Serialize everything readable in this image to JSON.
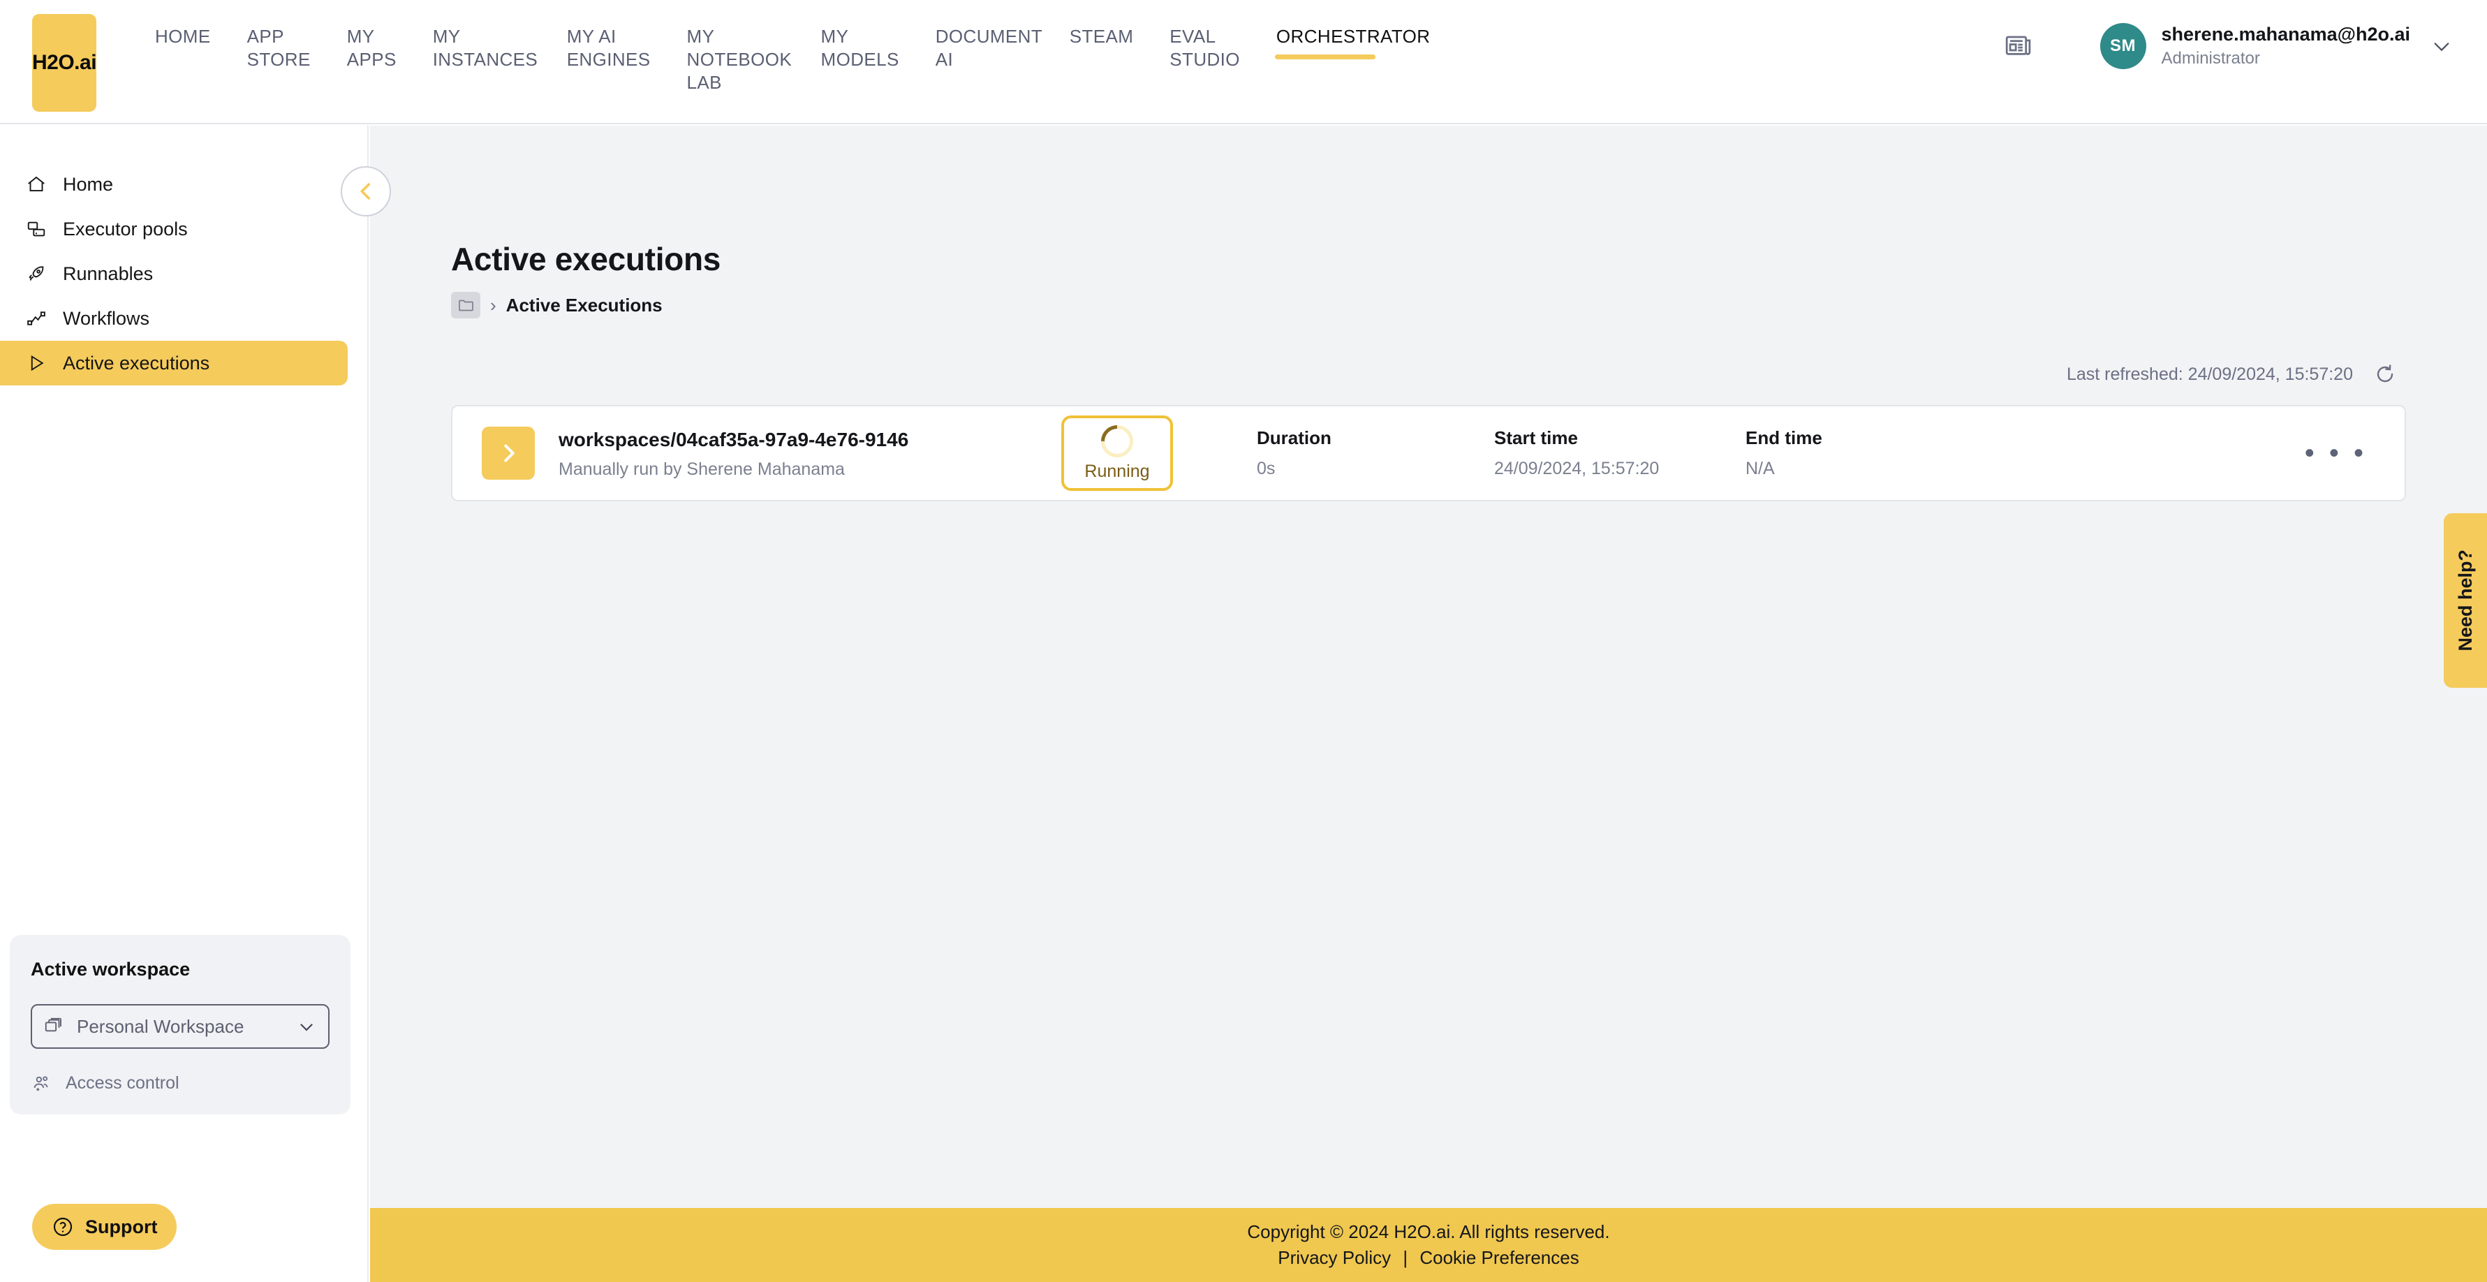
{
  "brand": {
    "logo_text": "H2O.ai",
    "accent_yellow": "#F5CB5C",
    "accent_yellow_dark": "#F0C136",
    "avatar_teal": "#2F8A8A",
    "text_dark": "#15161a",
    "text_muted": "#7b808f"
  },
  "topnav": {
    "items": [
      {
        "label": "HOME",
        "active": false
      },
      {
        "label": "APP\nSTORE",
        "active": false
      },
      {
        "label": "MY\nAPPS",
        "active": false
      },
      {
        "label": "MY\nINSTANCES",
        "active": false
      },
      {
        "label": "MY AI\nENGINES",
        "active": false
      },
      {
        "label": "MY\nNOTEBOOK\nLAB",
        "active": false
      },
      {
        "label": "MY\nMODELS",
        "active": false
      },
      {
        "label": "DOCUMENT\nAI",
        "active": false
      },
      {
        "label": "STEAM",
        "active": false
      },
      {
        "label": "EVAL\nSTUDIO",
        "active": false
      },
      {
        "label": "ORCHESTRATOR",
        "active": true
      }
    ],
    "news_icon": "newspaper-icon",
    "user": {
      "initials": "SM",
      "email": "sherene.mahanama@h2o.ai",
      "role": "Administrator",
      "caret_icon": "chevron-down-icon"
    }
  },
  "sidebar": {
    "collapse_icon": "chevron-left-icon",
    "items": [
      {
        "label": "Home",
        "icon": "home-icon",
        "selected": false
      },
      {
        "label": "Executor pools",
        "icon": "executor-pools-icon",
        "selected": false
      },
      {
        "label": "Runnables",
        "icon": "rocket-icon",
        "selected": false
      },
      {
        "label": "Workflows",
        "icon": "workflow-icon",
        "selected": false
      },
      {
        "label": "Active executions",
        "icon": "play-triangle-icon",
        "selected": true
      }
    ],
    "workspace": {
      "title": "Active workspace",
      "selected": "Personal Workspace",
      "select_icon": "stacked-windows-icon",
      "caret_icon": "chevron-down-icon",
      "access_control_label": "Access control",
      "access_control_icon": "people-add-icon"
    },
    "support": {
      "label": "Support",
      "icon": "question-circle-icon"
    }
  },
  "main": {
    "page_title": "Active executions",
    "breadcrumb": {
      "root_icon": "folder-icon",
      "separator": "›",
      "current": "Active Executions"
    },
    "refresh": {
      "text": "Last refreshed: 24/09/2024, 15:57:20",
      "icon": "refresh-icon"
    },
    "columns": {
      "duration": "Duration",
      "start_time": "Start time",
      "end_time": "End time"
    },
    "executions": [
      {
        "expand_icon": "chevron-right-icon",
        "name": "workspaces/04caf35a-97a9-4e76-9146",
        "subtitle": "Manually run by Sherene Mahanama",
        "status": "Running",
        "status_icon": "spinner-icon",
        "duration": "0s",
        "start_time": "24/09/2024, 15:57:20",
        "end_time": "N/A",
        "more_label": "• • •"
      }
    ]
  },
  "need_help": {
    "label": "Need help?"
  },
  "footer": {
    "copyright": "Copyright © 2024 H2O.ai. All rights reserved.",
    "privacy_policy": "Privacy Policy",
    "separator": "|",
    "cookie_preferences": "Cookie Preferences"
  }
}
